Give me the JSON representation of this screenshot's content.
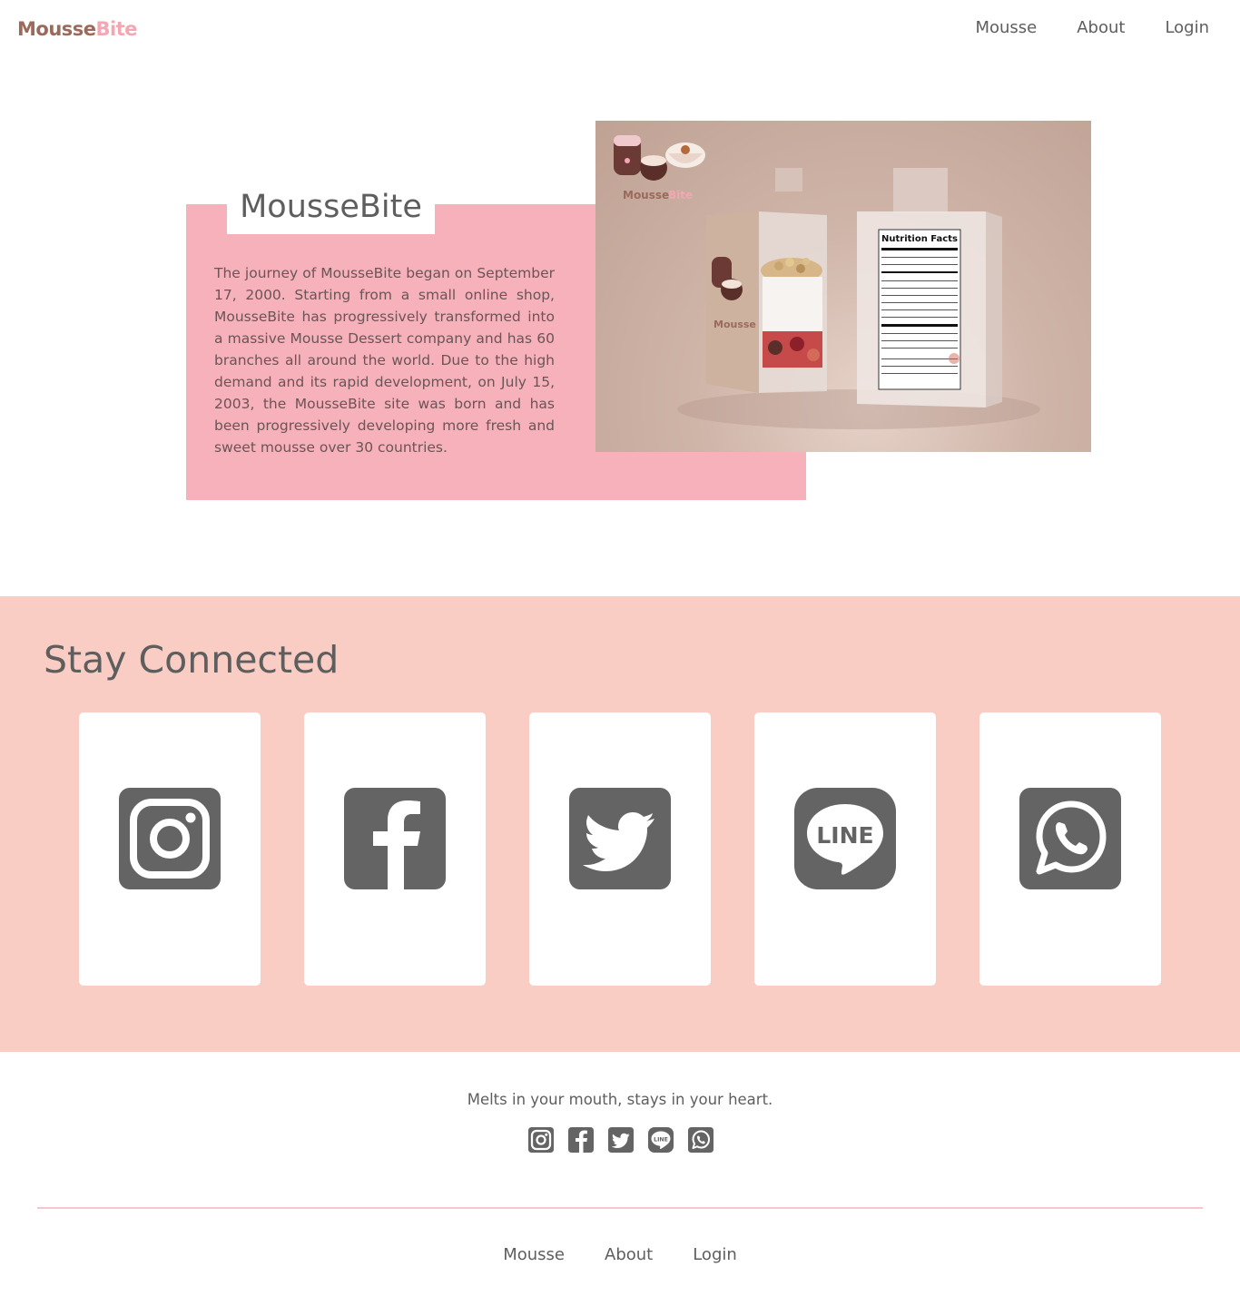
{
  "header": {
    "logo_part1": "Mousse",
    "logo_part2": "Bite",
    "nav": [
      "Mousse",
      "About",
      "Login"
    ]
  },
  "about": {
    "title": "MousseBite",
    "text": "The journey of MousseBite began on September 17, 2000. Starting from a small online shop, MousseBite has progressively transformed into a massive Mousse Dessert company and has 60 branches all around the world. Due to the high demand and its rapid development, on July 15, 2003, the MousseBite site was born and has been progressively developing more fresh and sweet mousse over 30 countries.",
    "image": {
      "label_title": "Nutrition Facts",
      "brand_part1": "Mousse",
      "brand_part2": "Bite"
    }
  },
  "connected": {
    "title": "Stay Connected",
    "cards": [
      {
        "icon": "instagram-icon"
      },
      {
        "icon": "facebook-icon"
      },
      {
        "icon": "twitter-icon"
      },
      {
        "icon": "line-icon",
        "text": "LINE"
      },
      {
        "icon": "whatsapp-icon"
      }
    ]
  },
  "footer": {
    "tagline": "Melts in your mouth, stays in your heart.",
    "icons": [
      "instagram-icon",
      "facebook-icon",
      "twitter-icon",
      "line-icon",
      "whatsapp-icon"
    ],
    "line_text": "LINE",
    "nav": [
      "Mousse",
      "About",
      "Login"
    ]
  },
  "colors": {
    "pink_box": "#f6b1ba",
    "connected_bg": "#f9cdc3",
    "icon_gray": "#646464",
    "logo_brown": "#9b6a5c",
    "logo_pink": "#f2a7b3",
    "text": "#5e5e5e"
  }
}
